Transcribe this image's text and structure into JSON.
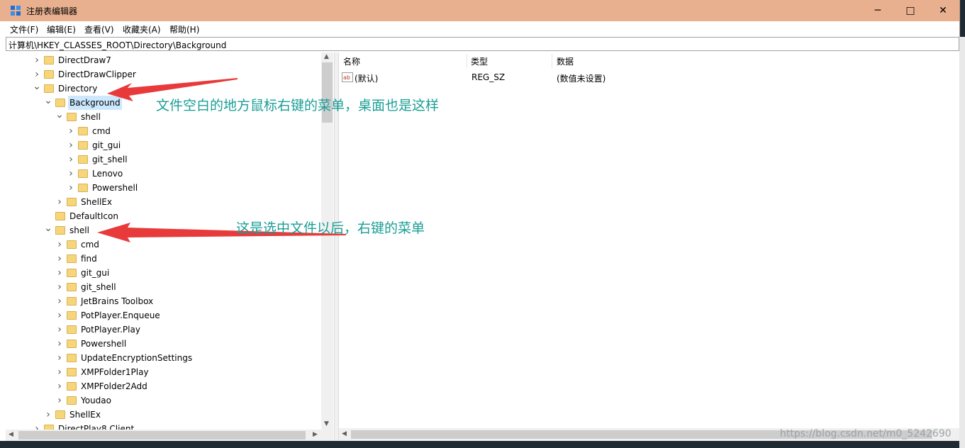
{
  "window": {
    "title": "注册表编辑器",
    "minimize": "─",
    "maximize": "□",
    "close": "✕",
    "accent": "#e8b08f"
  },
  "menu": [
    "文件(F)",
    "编辑(E)",
    "查看(V)",
    "收藏夹(A)",
    "帮助(H)"
  ],
  "address": "计算机\\HKEY_CLASSES_ROOT\\Directory\\Background",
  "tree": [
    {
      "label": "DirectDraw7",
      "depth": 0,
      "state": "collapsed"
    },
    {
      "label": "DirectDrawClipper",
      "depth": 0,
      "state": "collapsed"
    },
    {
      "label": "Directory",
      "depth": 0,
      "state": "expanded"
    },
    {
      "label": "Background",
      "depth": 1,
      "state": "expanded",
      "selected": true
    },
    {
      "label": "shell",
      "depth": 2,
      "state": "expanded"
    },
    {
      "label": "cmd",
      "depth": 3,
      "state": "collapsed"
    },
    {
      "label": "git_gui",
      "depth": 3,
      "state": "collapsed"
    },
    {
      "label": "git_shell",
      "depth": 3,
      "state": "collapsed"
    },
    {
      "label": "Lenovo",
      "depth": 3,
      "state": "collapsed"
    },
    {
      "label": "Powershell",
      "depth": 3,
      "state": "collapsed"
    },
    {
      "label": "ShellEx",
      "depth": 2,
      "state": "collapsed"
    },
    {
      "label": "DefaultIcon",
      "depth": 1,
      "state": "leaf"
    },
    {
      "label": "shell",
      "depth": 1,
      "state": "expanded"
    },
    {
      "label": "cmd",
      "depth": 2,
      "state": "collapsed"
    },
    {
      "label": "find",
      "depth": 2,
      "state": "collapsed"
    },
    {
      "label": "git_gui",
      "depth": 2,
      "state": "collapsed"
    },
    {
      "label": "git_shell",
      "depth": 2,
      "state": "collapsed"
    },
    {
      "label": "JetBrains Toolbox",
      "depth": 2,
      "state": "collapsed"
    },
    {
      "label": "PotPlayer.Enqueue",
      "depth": 2,
      "state": "collapsed"
    },
    {
      "label": "PotPlayer.Play",
      "depth": 2,
      "state": "collapsed"
    },
    {
      "label": "Powershell",
      "depth": 2,
      "state": "collapsed"
    },
    {
      "label": "UpdateEncryptionSettings",
      "depth": 2,
      "state": "collapsed"
    },
    {
      "label": "XMPFolder1Play",
      "depth": 2,
      "state": "collapsed"
    },
    {
      "label": "XMPFolder2Add",
      "depth": 2,
      "state": "collapsed"
    },
    {
      "label": "Youdao",
      "depth": 2,
      "state": "collapsed"
    },
    {
      "label": "ShellEx",
      "depth": 1,
      "state": "collapsed"
    },
    {
      "label": "DirectPlay8 Client",
      "depth": 0,
      "state": "collapsed"
    }
  ],
  "list": {
    "columns": [
      "名称",
      "类型",
      "数据"
    ],
    "rows": [
      {
        "name": "(默认)",
        "type": "REG_SZ",
        "data": "(数值未设置)"
      }
    ]
  },
  "annotations": {
    "background_note": "文件空白的地方鼠标右键的菜单，桌面也是这样",
    "shell_note": "这是选中文件以后，右键的菜单",
    "color": "#1a9e96",
    "arrow_color": "#e83a3a"
  },
  "watermark": "https://blog.csdn.net/m0_5242690"
}
